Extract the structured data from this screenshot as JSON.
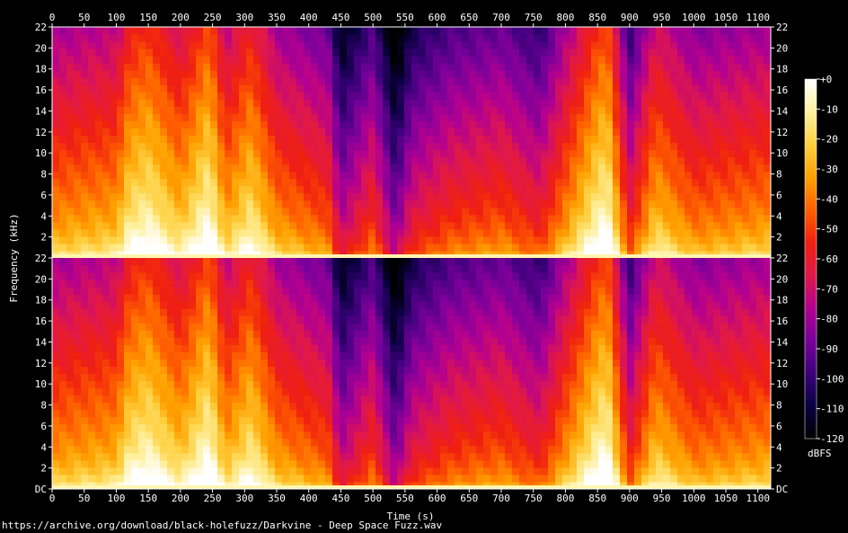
{
  "chart_data": {
    "type": "heatmap",
    "xlabel": "Time (s)",
    "ylabel": "Frequency (kHz)",
    "xlim": [
      0,
      1120
    ],
    "x_ticks": [
      0,
      50,
      100,
      150,
      200,
      250,
      300,
      350,
      400,
      450,
      500,
      550,
      600,
      650,
      700,
      750,
      800,
      850,
      900,
      950,
      1000,
      1050,
      1100
    ],
    "y_ticks": [
      "DC",
      "2",
      "4",
      "6",
      "8",
      "10",
      "12",
      "14",
      "16",
      "18",
      "20",
      "22"
    ],
    "channels": 2,
    "ylim_khz": [
      0,
      22
    ],
    "colorbar": {
      "label": "dBFS",
      "range": [
        -120,
        0
      ],
      "ticks": [
        "+0",
        "-10",
        "-20",
        "-30",
        "-40",
        "-50",
        "-60",
        "-70",
        "-80",
        "-90",
        "-100",
        "-110",
        "-120"
      ],
      "colors": [
        "#000000",
        "#0a0040",
        "#3c007a",
        "#78009a",
        "#b40090",
        "#e0184a",
        "#f02010",
        "#ff6000",
        "#ffa000",
        "#ffd040",
        "#fff0a0",
        "#ffffff"
      ]
    },
    "loudness_profile": [
      {
        "t": 0,
        "level": 0.55
      },
      {
        "t": 100,
        "level": 0.6
      },
      {
        "t": 120,
        "level": 0.75
      },
      {
        "t": 150,
        "level": 0.8
      },
      {
        "t": 200,
        "level": 0.65
      },
      {
        "t": 245,
        "level": 0.85
      },
      {
        "t": 270,
        "level": 0.6
      },
      {
        "t": 310,
        "level": 0.75
      },
      {
        "t": 350,
        "level": 0.55
      },
      {
        "t": 430,
        "level": 0.45
      },
      {
        "t": 450,
        "level": 0.2
      },
      {
        "t": 500,
        "level": 0.4
      },
      {
        "t": 535,
        "level": 0.1
      },
      {
        "t": 560,
        "level": 0.3
      },
      {
        "t": 620,
        "level": 0.4
      },
      {
        "t": 700,
        "level": 0.45
      },
      {
        "t": 760,
        "level": 0.35
      },
      {
        "t": 850,
        "level": 0.8
      },
      {
        "t": 865,
        "level": 0.85
      },
      {
        "t": 900,
        "level": 0.35
      },
      {
        "t": 940,
        "level": 0.65
      },
      {
        "t": 1000,
        "level": 0.5
      },
      {
        "t": 1110,
        "level": 0.55
      }
    ]
  },
  "footer": {
    "source_url": "https://archive.org/download/black-holefuzz/Darkvine - Deep Space Fuzz.wav"
  }
}
